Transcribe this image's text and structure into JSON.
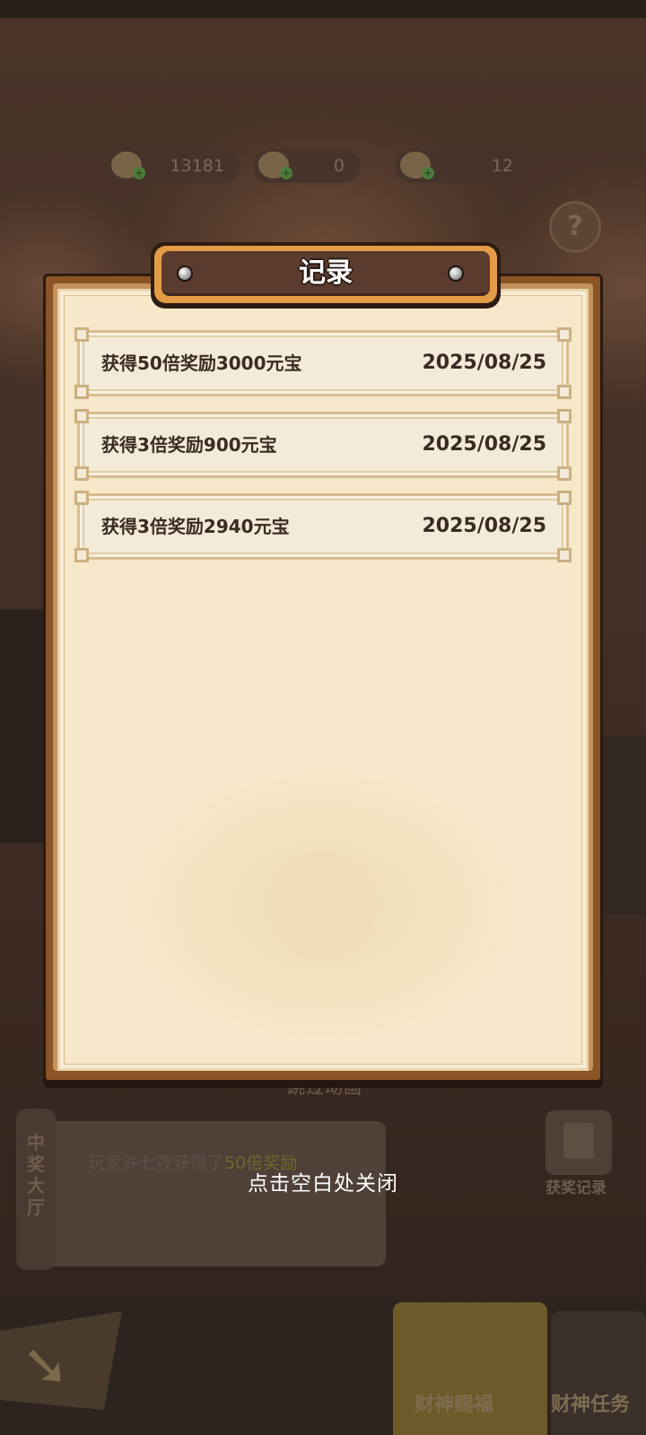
{
  "background": {
    "resources": [
      {
        "name": "gold-ingot-icon",
        "value": "13181"
      },
      {
        "name": "coin-icon",
        "value": "0"
      },
      {
        "name": "token-icon",
        "value": "12"
      }
    ],
    "skip_animation_label": "跳过动画",
    "hall": {
      "title": "中奖大厅",
      "message_prefix": "玩家许七夜获得了",
      "message_highlight": "50倍奖励"
    },
    "win_records_label": "获奖记录",
    "tabs": [
      {
        "label": "财神赐福",
        "active": true
      },
      {
        "label": "财神任务",
        "active": false
      }
    ]
  },
  "modal": {
    "title": "记录",
    "records": [
      {
        "description": "获得50倍奖励3000元宝",
        "date": "2025/08/25"
      },
      {
        "description": "获得3倍奖励900元宝",
        "date": "2025/08/25"
      },
      {
        "description": "获得3倍奖励2940元宝",
        "date": "2025/08/25"
      }
    ]
  },
  "close_hint": "点击空白处关闭",
  "colors": {
    "frame": "#8a5426",
    "parchment": "#f6e8c8",
    "title_plate": "#5b3b2e",
    "title_rim": "#e39b45",
    "row_text": "#3a2b22"
  }
}
